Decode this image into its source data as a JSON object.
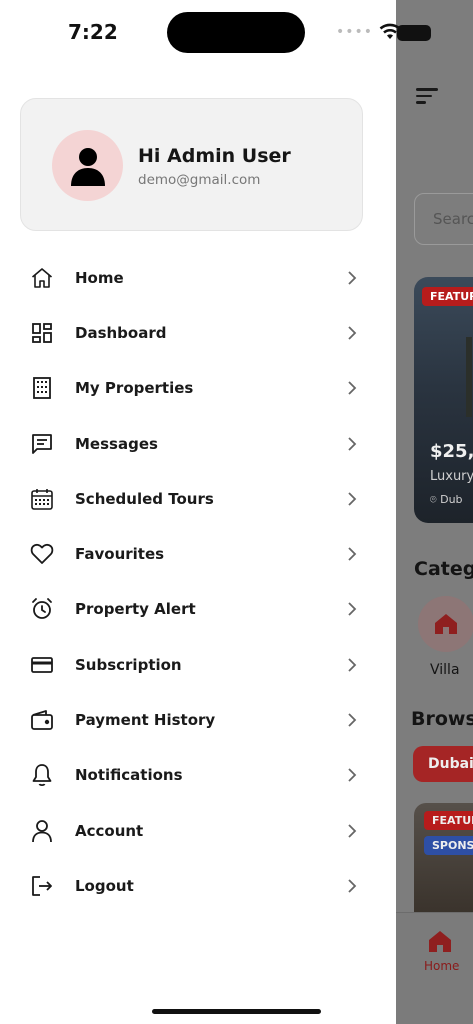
{
  "status_bar": {
    "time": "7:22"
  },
  "drawer": {
    "profile": {
      "greeting": "Hi Admin User",
      "email": "demo@gmail.com"
    },
    "menu_items": [
      {
        "label": "Home",
        "icon": "home-icon"
      },
      {
        "label": "Dashboard",
        "icon": "dashboard-icon"
      },
      {
        "label": "My Properties",
        "icon": "building-icon"
      },
      {
        "label": "Messages",
        "icon": "message-icon"
      },
      {
        "label": "Scheduled Tours",
        "icon": "calendar-icon"
      },
      {
        "label": "Favourites",
        "icon": "heart-icon"
      },
      {
        "label": "Property Alert",
        "icon": "alarm-icon"
      },
      {
        "label": "Subscription",
        "icon": "credit-card-icon"
      },
      {
        "label": "Payment History",
        "icon": "wallet-icon"
      },
      {
        "label": "Notifications",
        "icon": "bell-icon"
      },
      {
        "label": "Account",
        "icon": "user-icon"
      },
      {
        "label": "Logout",
        "icon": "logout-icon"
      }
    ]
  },
  "background_app": {
    "search_placeholder": "Searc",
    "featured_badge": "FEATUR",
    "price": "$25,",
    "property_title": "Luxury",
    "location": "Dub",
    "categories_heading": "Categ",
    "category_label": "Villa",
    "browse_heading": "Browse",
    "city_pill": "Dubai",
    "featured_badge_2": "FEATUR",
    "sponsored_badge": "SPONS",
    "tab_home": "Home"
  },
  "colors": {
    "accent": "#c62828",
    "avatar_bg": "#f4d4d4",
    "card_bg": "#f2f2f2"
  }
}
